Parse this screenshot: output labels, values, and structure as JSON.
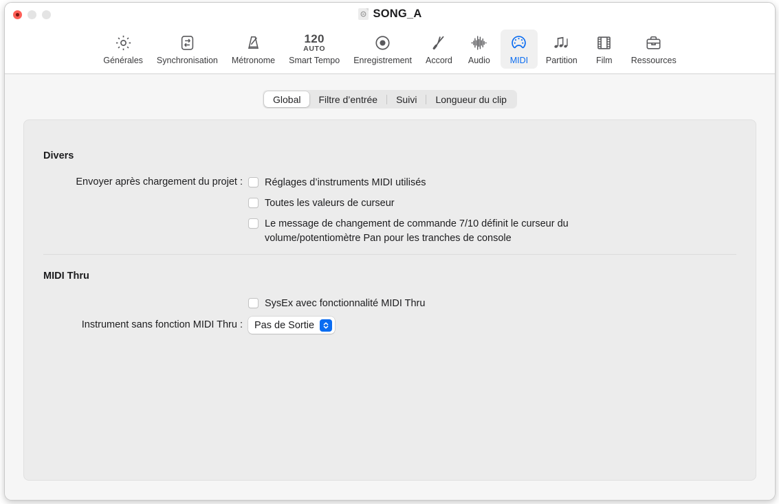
{
  "window": {
    "title": "SONG_A",
    "traffic_lights": [
      "close",
      "minimize",
      "maximize"
    ]
  },
  "toolbar": {
    "items": [
      {
        "label": "Générales",
        "icon": "gear-icon",
        "selected": false
      },
      {
        "label": "Synchronisation",
        "icon": "sync-icon",
        "selected": false
      },
      {
        "label": "Métronome",
        "icon": "metronome-icon",
        "selected": false
      },
      {
        "label": "Smart Tempo",
        "icon": "tempo-icon",
        "selected": false,
        "tempo_value": "120",
        "tempo_mode": "AUTO"
      },
      {
        "label": "Enregistrement",
        "icon": "record-icon",
        "selected": false
      },
      {
        "label": "Accord",
        "icon": "tuning-fork-icon",
        "selected": false
      },
      {
        "label": "Audio",
        "icon": "waveform-icon",
        "selected": false
      },
      {
        "label": "MIDI",
        "icon": "midi-din-icon",
        "selected": true
      },
      {
        "label": "Partition",
        "icon": "notes-icon",
        "selected": false
      },
      {
        "label": "Film",
        "icon": "film-strip-icon",
        "selected": false
      },
      {
        "label": "Ressources",
        "icon": "briefcase-icon",
        "selected": false
      }
    ]
  },
  "tabs": {
    "items": [
      {
        "label": "Global",
        "active": true
      },
      {
        "label": "Filtre d’entrée",
        "active": false
      },
      {
        "label": "Suivi",
        "active": false
      },
      {
        "label": "Longueur du clip",
        "active": false
      }
    ]
  },
  "sections": {
    "divers": {
      "title": "Divers",
      "send_label": "Envoyer après chargement du projet :",
      "checkboxes": [
        {
          "label": "Réglages d’instruments MIDI utilisés",
          "checked": false
        },
        {
          "label": "Toutes les valeurs de curseur",
          "checked": false
        },
        {
          "label": "Le message de changement de commande 7/10 définit le curseur du volume/potentiomètre Pan pour les tranches de console",
          "checked": false
        }
      ]
    },
    "midi_thru": {
      "title": "MIDI Thru",
      "sysex_checkbox": {
        "label": "SysEx avec fonctionnalité MIDI Thru",
        "checked": false
      },
      "instrument_label": "Instrument sans fonction MIDI Thru :",
      "instrument_value": "Pas de Sortie"
    }
  },
  "colors": {
    "accent": "#0a6cf1",
    "close": "#ff5f57",
    "panel_bg": "#ececec",
    "window_bg": "#f6f6f6",
    "text": "#1c1c1e"
  }
}
